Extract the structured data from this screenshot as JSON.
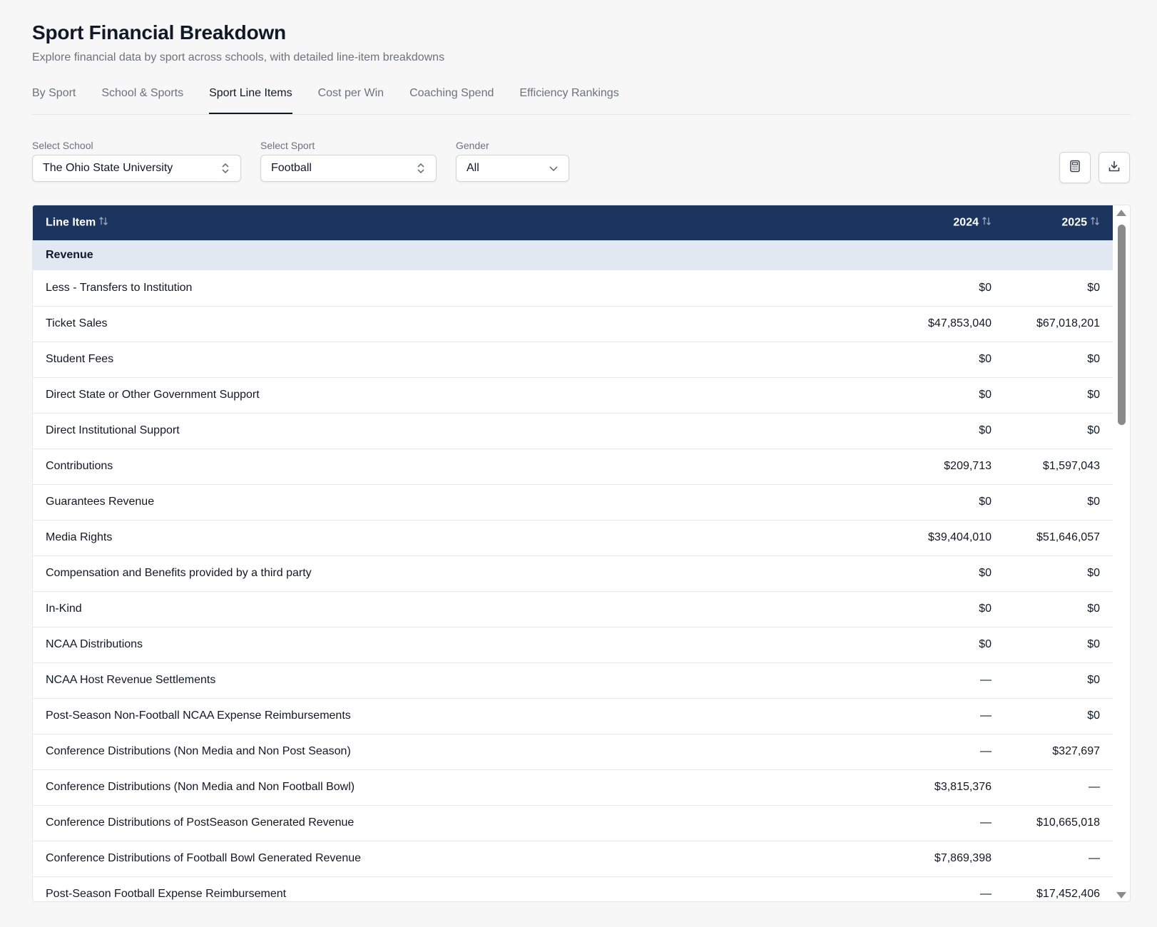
{
  "header": {
    "title": "Sport Financial Breakdown",
    "subtitle": "Explore financial data by sport across schools, with detailed line-item breakdowns"
  },
  "tabs": [
    {
      "label": "By Sport",
      "active": false
    },
    {
      "label": "School & Sports",
      "active": false
    },
    {
      "label": "Sport Line Items",
      "active": true
    },
    {
      "label": "Cost per Win",
      "active": false
    },
    {
      "label": "Coaching Spend",
      "active": false
    },
    {
      "label": "Efficiency Rankings",
      "active": false
    }
  ],
  "filters": {
    "school": {
      "label": "Select School",
      "value": "The Ohio State University",
      "icon": "chevron-up-down-icon"
    },
    "sport": {
      "label": "Select Sport",
      "value": "Football",
      "icon": "chevron-up-down-icon"
    },
    "gender": {
      "label": "Gender",
      "value": "All",
      "icon": "chevron-down-icon"
    }
  },
  "actions": {
    "calculator_icon": "calculator-icon",
    "download_icon": "download-icon"
  },
  "table": {
    "headers": {
      "item": "Line Item",
      "y1": "2024",
      "y2": "2025"
    },
    "section": "Revenue",
    "rows": [
      {
        "item": "Less - Transfers to Institution",
        "y1": "$0",
        "y2": "$0"
      },
      {
        "item": "Ticket Sales",
        "y1": "$47,853,040",
        "y2": "$67,018,201"
      },
      {
        "item": "Student Fees",
        "y1": "$0",
        "y2": "$0"
      },
      {
        "item": "Direct State or Other Government Support",
        "y1": "$0",
        "y2": "$0"
      },
      {
        "item": "Direct Institutional Support",
        "y1": "$0",
        "y2": "$0"
      },
      {
        "item": "Contributions",
        "y1": "$209,713",
        "y2": "$1,597,043"
      },
      {
        "item": "Guarantees Revenue",
        "y1": "$0",
        "y2": "$0"
      },
      {
        "item": "Media Rights",
        "y1": "$39,404,010",
        "y2": "$51,646,057"
      },
      {
        "item": "Compensation and Benefits provided by a third party",
        "y1": "$0",
        "y2": "$0"
      },
      {
        "item": "In-Kind",
        "y1": "$0",
        "y2": "$0"
      },
      {
        "item": "NCAA Distributions",
        "y1": "$0",
        "y2": "$0"
      },
      {
        "item": "NCAA Host Revenue Settlements",
        "y1": "—",
        "y2": "$0"
      },
      {
        "item": "Post-Season Non-Football NCAA Expense Reimbursements",
        "y1": "—",
        "y2": "$0"
      },
      {
        "item": "Conference Distributions (Non Media and Non Post Season)",
        "y1": "—",
        "y2": "$327,697"
      },
      {
        "item": "Conference Distributions (Non Media and Non Football Bowl)",
        "y1": "$3,815,376",
        "y2": "—"
      },
      {
        "item": "Conference Distributions of PostSeason Generated Revenue",
        "y1": "—",
        "y2": "$10,665,018"
      },
      {
        "item": "Conference Distributions of Football Bowl Generated Revenue",
        "y1": "$7,869,398",
        "y2": "—"
      },
      {
        "item": "Post-Season Football Expense Reimbursement",
        "y1": "—",
        "y2": "$17,452,406"
      }
    ]
  }
}
